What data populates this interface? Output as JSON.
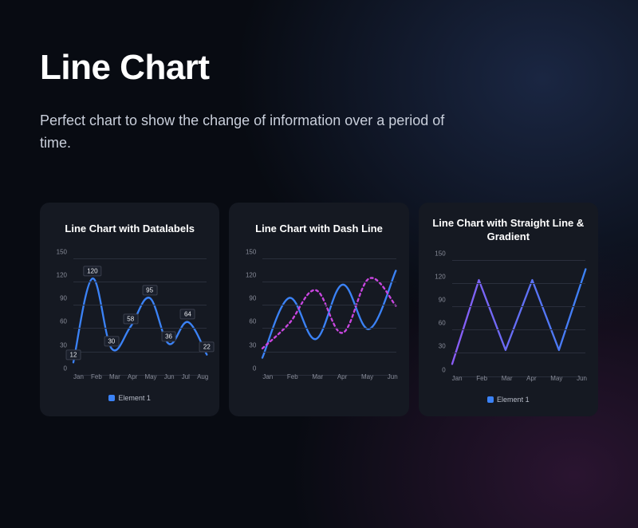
{
  "page": {
    "title": "Line Chart",
    "subtitle": "Perfect chart  to show the change of information over a period of time."
  },
  "cards": [
    {
      "title": "Line Chart with Datalabels"
    },
    {
      "title": "Line Chart with Dash Line"
    },
    {
      "title": "Line Chart with Straight Line & Gradient"
    }
  ],
  "legend": {
    "label": "Element 1"
  },
  "chart_data": [
    {
      "type": "line",
      "title": "Line Chart with Datalabels",
      "categories": [
        "Jan",
        "Feb",
        "Mar",
        "Apr",
        "May",
        "Jun",
        "Jul",
        "Aug"
      ],
      "values": [
        12,
        120,
        30,
        58,
        95,
        36,
        64,
        22
      ],
      "ylim": [
        0,
        150
      ],
      "yticks": [
        0,
        30,
        60,
        90,
        120,
        150
      ],
      "show_datalabels": true,
      "color": "#3b82f6",
      "style": "smooth",
      "legend": "Element 1"
    },
    {
      "type": "line",
      "title": "Line Chart with Dash Line",
      "categories": [
        "Jan",
        "Feb",
        "Mar",
        "Apr",
        "May",
        "Jun"
      ],
      "series": [
        {
          "name": "solid",
          "values": [
            18,
            95,
            42,
            112,
            55,
            130
          ],
          "color": "#3b82f6",
          "dash": false
        },
        {
          "name": "dashed",
          "values": [
            30,
            62,
            105,
            50,
            120,
            85
          ],
          "color": "#c946e0",
          "dash": true
        }
      ],
      "ylim": [
        0,
        150
      ],
      "yticks": [
        0,
        30,
        60,
        90,
        120,
        150
      ],
      "style": "smooth"
    },
    {
      "type": "line",
      "title": "Line Chart with Straight Line & Gradient",
      "categories": [
        "Jan",
        "Feb",
        "Mar",
        "Apr",
        "May",
        "Jun"
      ],
      "values": [
        12,
        120,
        30,
        120,
        30,
        134
      ],
      "ylim": [
        0,
        150
      ],
      "yticks": [
        0,
        30,
        60,
        90,
        120,
        150
      ],
      "style": "straight",
      "gradient": [
        "#8b5cf6",
        "#3b82f6"
      ],
      "legend": "Element 1"
    }
  ]
}
